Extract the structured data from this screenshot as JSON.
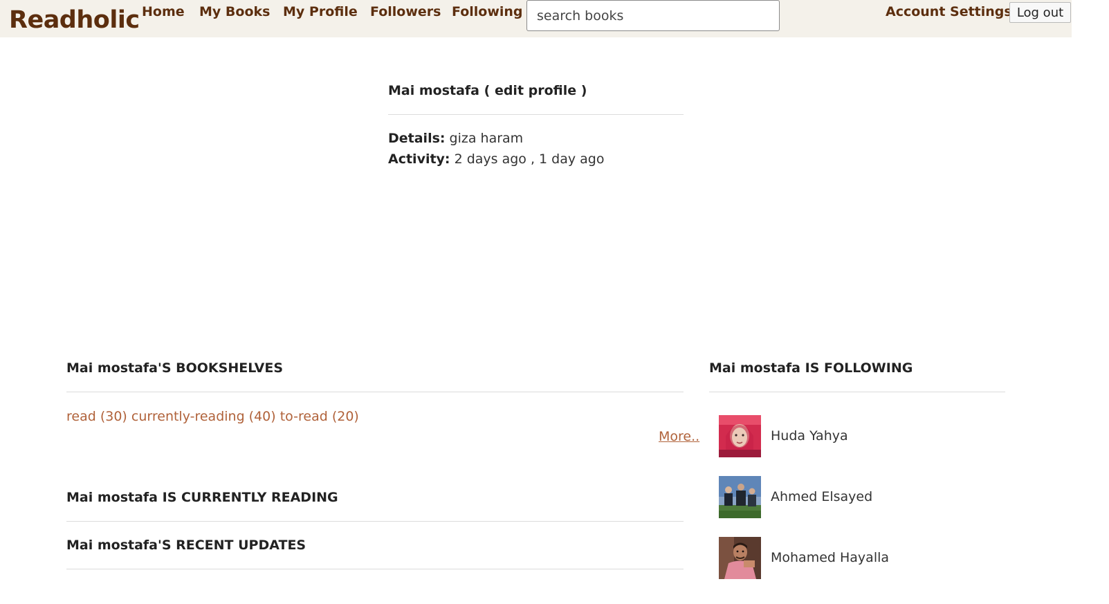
{
  "navbar": {
    "brand": "Readholic",
    "links": [
      "Home",
      "My Books",
      "My Profile",
      "Followers",
      "Following"
    ],
    "search_placeholder": "search books",
    "account_settings": "Account Settings",
    "logout": "Log out"
  },
  "profile": {
    "name": "Mai mostafa",
    "edit_label": "( edit profile )",
    "details_label": "Details:",
    "details_value": "giza haram",
    "activity_label": "Activity:",
    "activity_value": "2 days ago , 1 day ago"
  },
  "bookshelves": {
    "title": "Mai mostafa'S BOOKSHELVES",
    "shelves": [
      "read (30)",
      "currently-reading (40)",
      "to-read (20)"
    ],
    "more": "More.."
  },
  "currently_reading": {
    "title": "Mai mostafa IS CURRENTLY READING"
  },
  "recent_updates": {
    "title": "Mai mostafa'S RECENT UPDATES"
  },
  "following": {
    "title": "Mai mostafa IS FOLLOWING",
    "users": [
      {
        "name": "Huda Yahya",
        "avatar": "woman-red-hijab-photo"
      },
      {
        "name": "Ahmed Elsayed",
        "avatar": "men-outdoor-photo"
      },
      {
        "name": "Mohamed Hayalla",
        "avatar": "man-pink-shirt-photo"
      }
    ]
  },
  "colors": {
    "brand": "#5c2e0e",
    "navbar_bg": "#f4f1ea",
    "link": "#b0623a"
  }
}
